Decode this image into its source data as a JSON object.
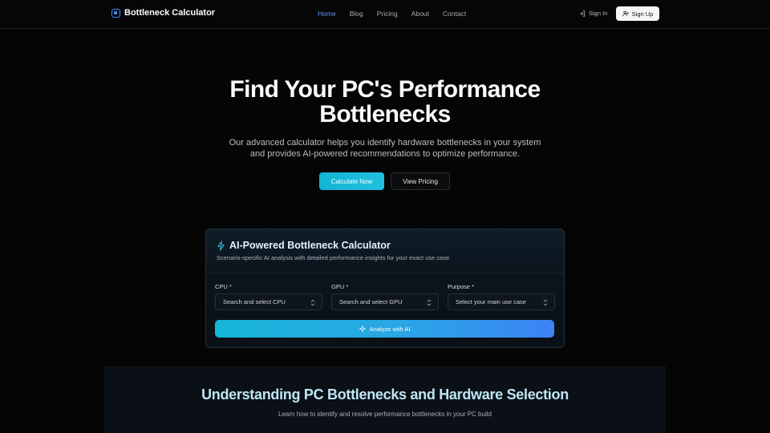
{
  "header": {
    "brand": "Bottleneck Calculator",
    "nav": [
      {
        "label": "Home",
        "active": true
      },
      {
        "label": "Blog",
        "active": false
      },
      {
        "label": "Pricing",
        "active": false
      },
      {
        "label": "About",
        "active": false
      },
      {
        "label": "Contact",
        "active": false
      }
    ],
    "signin_label": "Sign In",
    "signup_label": "Sign Up"
  },
  "hero": {
    "title_line1": "Find Your PC's Performance",
    "title_line2": "Bottlenecks",
    "subtitle_line1": "Our advanced calculator helps you identify hardware bottlenecks in your system",
    "subtitle_line2": "and provides AI-powered recommendations to optimize performance.",
    "primary_button": "Calculate Now",
    "secondary_button": "View Pricing"
  },
  "calculator": {
    "title": "AI-Powered Bottleneck Calculator",
    "description": "Scenario-specific AI analysis with detailed performance insights for your exact use case",
    "fields": [
      {
        "label": "CPU *",
        "placeholder": "Search and select CPU"
      },
      {
        "label": "GPU *",
        "placeholder": "Search and select GPU"
      },
      {
        "label": "Purpose *",
        "placeholder": "Select your main use case"
      }
    ],
    "analyze_button": "Analyze with AI"
  },
  "section": {
    "title": "Understanding PC Bottlenecks and Hardware Selection",
    "subtitle": "Learn how to identify and resolve performance bottlenecks in your PC build"
  },
  "colors": {
    "accent": "#5b9bff",
    "cyan": "#12b5d4",
    "blue": "#3d82f4",
    "background": "#050505"
  }
}
